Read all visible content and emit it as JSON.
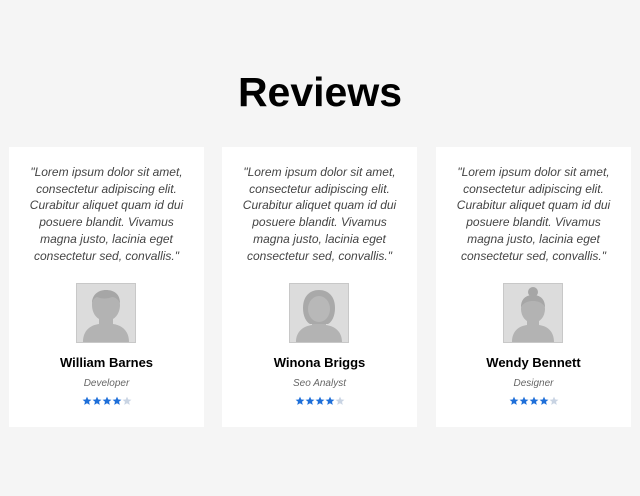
{
  "header": {
    "title": "Reviews"
  },
  "colors": {
    "background": "#f5f5f5",
    "card": "#ffffff",
    "star_filled": "#1e6fd9",
    "star_empty": "#c9d4e3",
    "avatar_bg": "#dcdcdc",
    "avatar_fg": "#b3b3b3"
  },
  "reviews": [
    {
      "quote": "\"Lorem ipsum dolor sit amet, consectetur adipiscing elit. Curabitur aliquet quam id dui posuere blandit. Vivamus magna justo, lacinia eget consectetur sed, convallis.\"",
      "name": "William Barnes",
      "role": "Developer",
      "avatar_icon": "male-avatar-icon",
      "rating": 4,
      "rating_max": 5
    },
    {
      "quote": "\"Lorem ipsum dolor sit amet, consectetur adipiscing elit. Curabitur aliquet quam id dui posuere blandit. Vivamus magna justo, lacinia eget consectetur sed, convallis.\"",
      "name": "Winona Briggs",
      "role": "Seo Analyst",
      "avatar_icon": "female-avatar-icon",
      "rating": 4,
      "rating_max": 5
    },
    {
      "quote": "\"Lorem ipsum dolor sit amet, consectetur adipiscing elit. Curabitur aliquet quam id dui posuere blandit. Vivamus magna justo, lacinia eget consectetur sed, convallis.\"",
      "name": "Wendy Bennett",
      "role": "Designer",
      "avatar_icon": "female-bun-avatar-icon",
      "rating": 4,
      "rating_max": 5
    }
  ]
}
